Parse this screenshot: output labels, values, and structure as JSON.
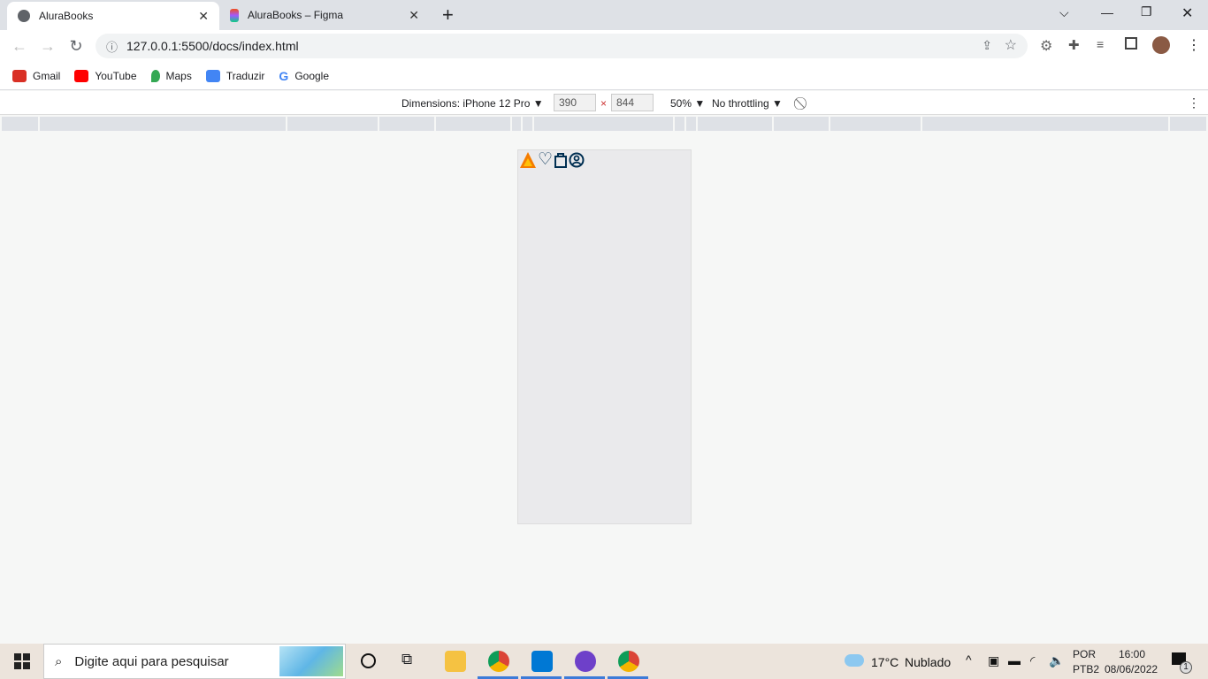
{
  "tabs": [
    {
      "title": "AluraBooks",
      "active": true,
      "icon": "globe-icon"
    },
    {
      "title": "AluraBooks – Figma",
      "active": false,
      "icon": "figma-icon"
    }
  ],
  "address": {
    "url": "127.0.0.1:5500/docs/index.html"
  },
  "bookmarks": [
    {
      "label": "Gmail",
      "color": "#d93025"
    },
    {
      "label": "YouTube",
      "color": "#ff0000"
    },
    {
      "label": "Maps",
      "color": "#34a853"
    },
    {
      "label": "Traduzir",
      "color": "#4285f4"
    },
    {
      "label": "Google",
      "color": "#4285f4"
    }
  ],
  "devtools": {
    "dimensions": "Dimensions: iPhone 12 Pro ▼",
    "width": "390",
    "times": "×",
    "height": "844",
    "zoom": "50% ▼",
    "throttling": "No throttling ▼"
  },
  "page": {
    "icons": [
      "logo-icon",
      "heart-icon",
      "bag-icon",
      "user-icon"
    ],
    "accent": "#f57c00"
  },
  "taskbar": {
    "search_placeholder": "Digite aqui para pesquisar",
    "temperature": "17°C",
    "weather": "Nublado",
    "lang1": "POR",
    "lang2": "PTB2",
    "time": "16:00",
    "date": "08/06/2022",
    "notifications": "1"
  }
}
